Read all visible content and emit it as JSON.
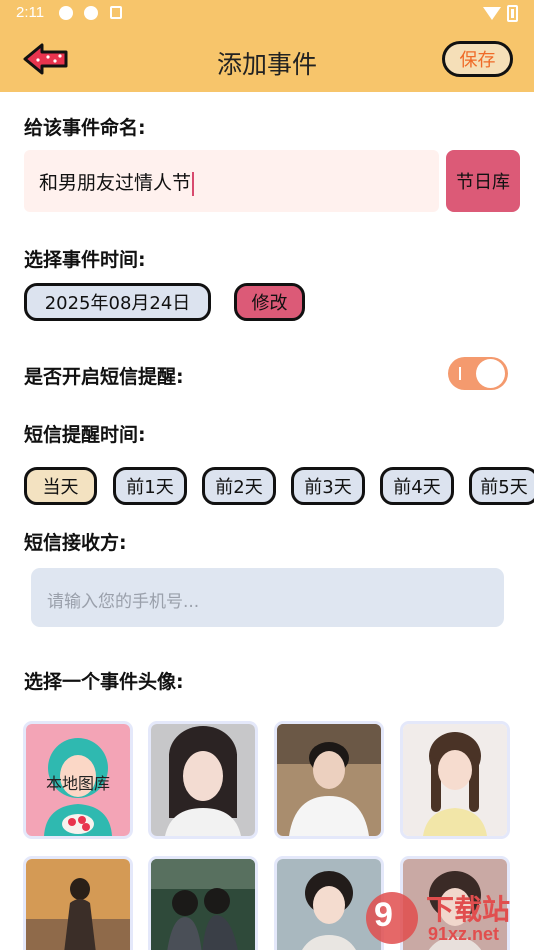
{
  "status_bar": {
    "time": "2:11"
  },
  "header": {
    "title": "添加事件",
    "save_label": "保存"
  },
  "event_name": {
    "label": "给该事件命名:",
    "value": "和男朋友过情人节",
    "holiday_button": "节日库"
  },
  "event_time": {
    "label": "选择事件时间:",
    "date": "2025年08月24日",
    "modify_button": "修改"
  },
  "sms_reminder": {
    "label": "是否开启短信提醒:",
    "enabled": true
  },
  "reminder_time": {
    "label": "短信提醒时间:",
    "options": [
      "当天",
      "前1天",
      "前2天",
      "前3天",
      "前4天",
      "前5天"
    ],
    "selected": "当天"
  },
  "recipient": {
    "label": "短信接收方:",
    "placeholder": "请输入您的手机号..."
  },
  "avatar_section": {
    "label": "选择一个事件头像:",
    "local_library": "本地图库"
  },
  "watermark": {
    "num": "9",
    "line1": "下载站",
    "line2": "91xz.net"
  },
  "colors": {
    "header_bg": "#f7c56b",
    "accent_pink": "#dc5a77",
    "save_text": "#ef6a28",
    "toggle_on": "#f49a6e",
    "chip_bg": "#dce3ef"
  }
}
